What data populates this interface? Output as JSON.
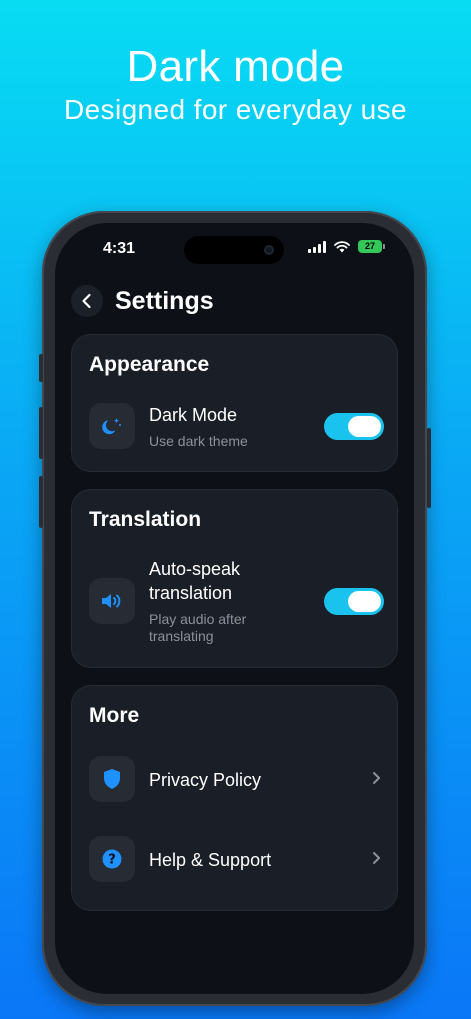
{
  "promo": {
    "title": "Dark mode",
    "subtitle": "Designed for everyday use"
  },
  "status_bar": {
    "time": "4:31",
    "battery": "27"
  },
  "header": {
    "back_icon": "chevron-left-icon",
    "title": "Settings"
  },
  "appearance": {
    "title": "Appearance",
    "dark_mode": {
      "icon": "moon-stars-icon",
      "label": "Dark Mode",
      "description": "Use dark theme",
      "enabled": true
    }
  },
  "translation": {
    "title": "Translation",
    "auto_speak": {
      "icon": "speaker-icon",
      "label_line1": "Auto-speak",
      "label_line2": "translation",
      "description_line1": "Play audio after",
      "description_line2": "translating",
      "enabled": true
    }
  },
  "more": {
    "title": "More",
    "items": [
      {
        "icon": "shield-icon",
        "label": "Privacy Policy"
      },
      {
        "icon": "help-circle-icon",
        "label": "Help & Support"
      }
    ]
  },
  "colors": {
    "accent": "#1ac3ee",
    "icon_blue": "#1e90ff",
    "background": "#0d1117",
    "card": "#1a1e26"
  }
}
